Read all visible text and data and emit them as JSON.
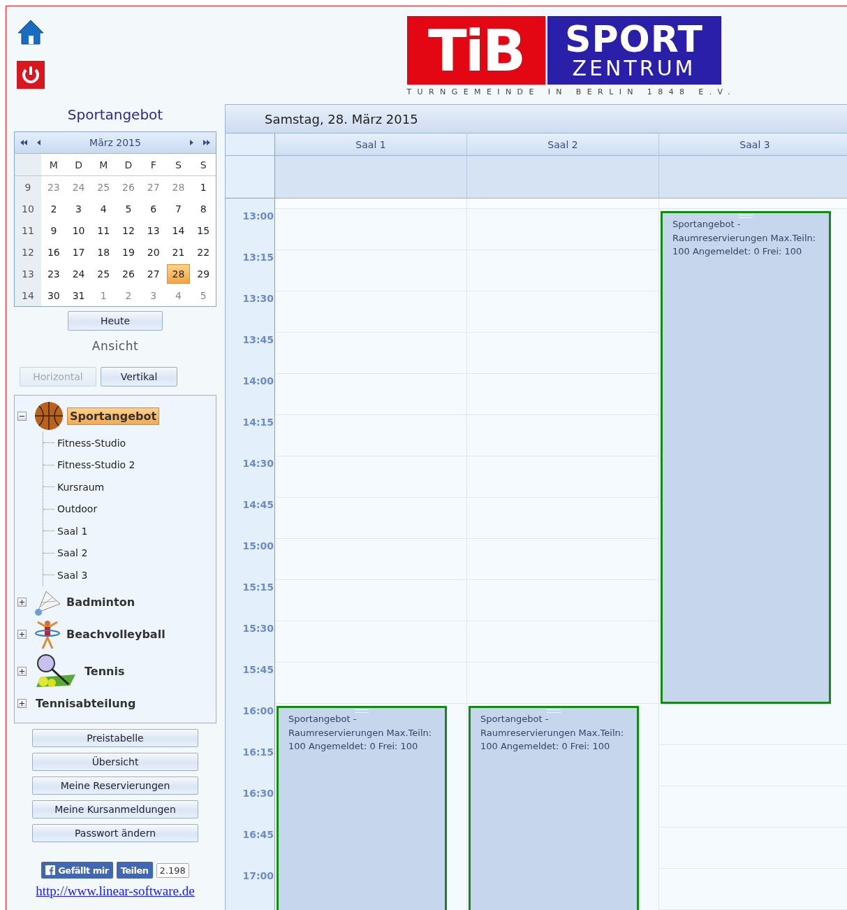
{
  "logo": {
    "mark": "TiB",
    "word1": "SPORT",
    "word2": "ZENTRUM",
    "subtitle": "TURNGEMEINDE IN BERLIN 1848 E.V."
  },
  "sidebar": {
    "title": "Sportangebot",
    "calendar": {
      "month": "März 2015",
      "weekdays": [
        "M",
        "D",
        "M",
        "D",
        "F",
        "S",
        "S"
      ],
      "weeks": [
        {
          "number": "9",
          "days": [
            {
              "day": "23",
              "other_month": true,
              "selected": false
            },
            {
              "day": "24",
              "other_month": true,
              "selected": false
            },
            {
              "day": "25",
              "other_month": true,
              "selected": false
            },
            {
              "day": "26",
              "other_month": true,
              "selected": false
            },
            {
              "day": "27",
              "other_month": true,
              "selected": false
            },
            {
              "day": "28",
              "other_month": true,
              "selected": false
            },
            {
              "day": "1",
              "other_month": false,
              "selected": false
            }
          ]
        },
        {
          "number": "10",
          "days": [
            {
              "day": "2",
              "other_month": false,
              "selected": false
            },
            {
              "day": "3",
              "other_month": false,
              "selected": false
            },
            {
              "day": "4",
              "other_month": false,
              "selected": false
            },
            {
              "day": "5",
              "other_month": false,
              "selected": false
            },
            {
              "day": "6",
              "other_month": false,
              "selected": false
            },
            {
              "day": "7",
              "other_month": false,
              "selected": false
            },
            {
              "day": "8",
              "other_month": false,
              "selected": false
            }
          ]
        },
        {
          "number": "11",
          "days": [
            {
              "day": "9",
              "other_month": false,
              "selected": false
            },
            {
              "day": "10",
              "other_month": false,
              "selected": false
            },
            {
              "day": "11",
              "other_month": false,
              "selected": false
            },
            {
              "day": "12",
              "other_month": false,
              "selected": false
            },
            {
              "day": "13",
              "other_month": false,
              "selected": false
            },
            {
              "day": "14",
              "other_month": false,
              "selected": false
            },
            {
              "day": "15",
              "other_month": false,
              "selected": false
            }
          ]
        },
        {
          "number": "12",
          "days": [
            {
              "day": "16",
              "other_month": false,
              "selected": false
            },
            {
              "day": "17",
              "other_month": false,
              "selected": false
            },
            {
              "day": "18",
              "other_month": false,
              "selected": false
            },
            {
              "day": "19",
              "other_month": false,
              "selected": false
            },
            {
              "day": "20",
              "other_month": false,
              "selected": false
            },
            {
              "day": "21",
              "other_month": false,
              "selected": false
            },
            {
              "day": "22",
              "other_month": false,
              "selected": false
            }
          ]
        },
        {
          "number": "13",
          "days": [
            {
              "day": "23",
              "other_month": false,
              "selected": false
            },
            {
              "day": "24",
              "other_month": false,
              "selected": false
            },
            {
              "day": "25",
              "other_month": false,
              "selected": false
            },
            {
              "day": "26",
              "other_month": false,
              "selected": false
            },
            {
              "day": "27",
              "other_month": false,
              "selected": false
            },
            {
              "day": "28",
              "other_month": false,
              "selected": true
            },
            {
              "day": "29",
              "other_month": false,
              "selected": false
            }
          ]
        },
        {
          "number": "14",
          "days": [
            {
              "day": "30",
              "other_month": false,
              "selected": false
            },
            {
              "day": "31",
              "other_month": false,
              "selected": false
            },
            {
              "day": "1",
              "other_month": true,
              "selected": false
            },
            {
              "day": "2",
              "other_month": true,
              "selected": false
            },
            {
              "day": "3",
              "other_month": true,
              "selected": false
            },
            {
              "day": "4",
              "other_month": true,
              "selected": false
            },
            {
              "day": "5",
              "other_month": true,
              "selected": false
            }
          ]
        }
      ]
    },
    "today_button": "Heute",
    "view_label": "Ansicht",
    "view_buttons": [
      {
        "label": "Horizontal",
        "disabled": true
      },
      {
        "label": "Vertikal",
        "disabled": false
      }
    ],
    "tree": [
      {
        "label": "Sportangebot",
        "kind": "basketball",
        "expanded": true,
        "selected": true,
        "children": [
          {
            "label": "Fitness-Studio"
          },
          {
            "label": "Fitness-Studio 2"
          },
          {
            "label": "Kursraum"
          },
          {
            "label": "Outdoor"
          },
          {
            "label": "Saal 1"
          },
          {
            "label": "Saal 2"
          },
          {
            "label": "Saal 3"
          }
        ]
      },
      {
        "label": "Badminton",
        "kind": "shuttlecock",
        "expanded": false,
        "selected": false
      },
      {
        "label": "Beachvolleyball",
        "kind": "hoop",
        "expanded": false,
        "selected": false
      },
      {
        "label": "Tennis",
        "kind": "tennis",
        "expanded": false,
        "selected": false
      },
      {
        "label": "Tennisabteilung",
        "kind": "none",
        "expanded": false,
        "selected": false
      }
    ],
    "menu_buttons": [
      "Preistabelle",
      "Übersicht",
      "Meine Reservierungen",
      "Meine Kursanmeldungen",
      "Passwort ändern"
    ],
    "social": {
      "like": "Gefällt mir",
      "share": "Teilen",
      "count": "2.198"
    },
    "link": "http://www.linear-software.de"
  },
  "scheduler": {
    "date": "Samstag, 28. März 2015",
    "times": [
      "13:00",
      "13:15",
      "13:30",
      "13:45",
      "14:00",
      "14:15",
      "14:30",
      "14:45",
      "15:00",
      "15:15",
      "15:30",
      "15:45",
      "16:00",
      "16:15",
      "16:30",
      "16:45",
      "17:00"
    ],
    "columns": [
      {
        "name": "Saal 1",
        "slots": [
          {
            "kind": "free"
          },
          {
            "kind": "free"
          },
          {
            "kind": "free"
          },
          {
            "kind": "free"
          },
          {
            "kind": "free"
          },
          {
            "kind": "free"
          },
          {
            "kind": "free"
          },
          {
            "kind": "free"
          },
          {
            "kind": "free"
          },
          {
            "kind": "free"
          },
          {
            "kind": "free"
          },
          {
            "kind": "free"
          },
          {
            "kind": "booked",
            "lines": [
              "Sportangebot -",
              "Raumreservierungen Max.Teiln:",
              "100 Angemeldet: 0 Frei: 100"
            ]
          },
          {
            "kind": "booked"
          },
          {
            "kind": "booked"
          },
          {
            "kind": "booked"
          },
          {
            "kind": "booked"
          }
        ]
      },
      {
        "name": "Saal 2",
        "slots": [
          {
            "kind": "free"
          },
          {
            "kind": "free"
          },
          {
            "kind": "free"
          },
          {
            "kind": "free"
          },
          {
            "kind": "free"
          },
          {
            "kind": "free"
          },
          {
            "kind": "free"
          },
          {
            "kind": "free"
          },
          {
            "kind": "free"
          },
          {
            "kind": "free"
          },
          {
            "kind": "free"
          },
          {
            "kind": "free"
          },
          {
            "kind": "booked",
            "lines": [
              "Sportangebot -",
              "Raumreservierungen Max.Teiln:",
              "100 Angemeldet: 0 Frei: 100"
            ]
          },
          {
            "kind": "booked"
          },
          {
            "kind": "booked"
          },
          {
            "kind": "booked"
          },
          {
            "kind": "booked"
          }
        ]
      },
      {
        "name": "Saal 3",
        "slots": [
          {
            "kind": "booked",
            "lines": [
              "Sportangebot -",
              "Raumreservierungen Max.Teiln:",
              "100 Angemeldet: 0 Frei: 100"
            ]
          },
          {
            "kind": "booked"
          },
          {
            "kind": "booked"
          },
          {
            "kind": "booked"
          },
          {
            "kind": "booked"
          },
          {
            "kind": "booked"
          },
          {
            "kind": "booked"
          },
          {
            "kind": "booked"
          },
          {
            "kind": "booked"
          },
          {
            "kind": "booked"
          },
          {
            "kind": "booked"
          },
          {
            "kind": "booked"
          },
          {
            "kind": "free"
          },
          {
            "kind": "free"
          },
          {
            "kind": "free"
          },
          {
            "kind": "free"
          },
          {
            "kind": "free"
          }
        ]
      }
    ]
  }
}
